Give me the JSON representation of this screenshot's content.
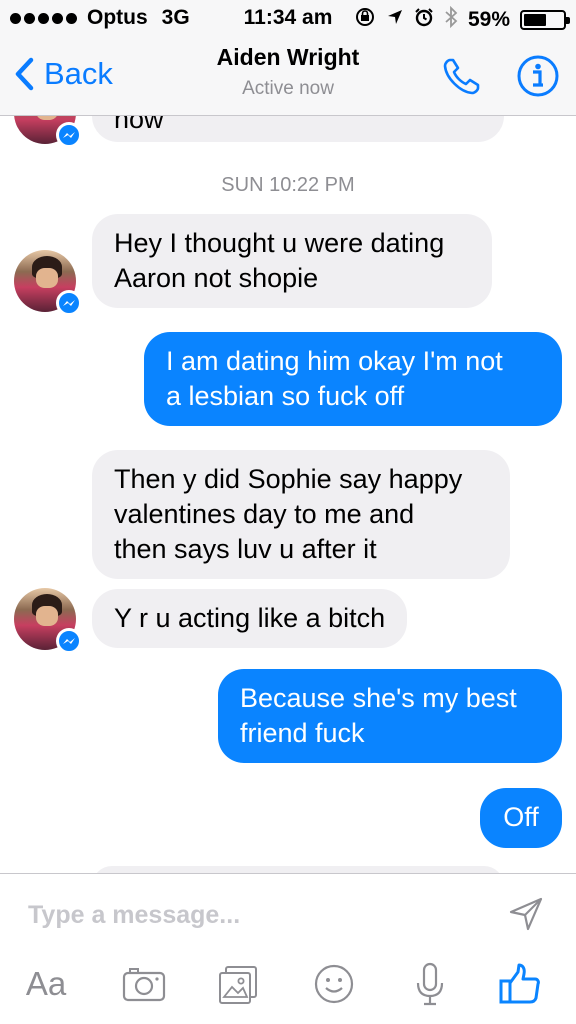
{
  "status_bar": {
    "carrier": "Optus",
    "network": "3G",
    "time": "11:34 am",
    "battery": "59%",
    "battery_level": 0.59
  },
  "nav": {
    "back_label": "Back",
    "contact_name": "Aiden Wright",
    "presence": "Active now"
  },
  "conversation": {
    "partial_top_text": "now",
    "timestamp": "SUN 10:22 PM",
    "messages": [
      {
        "sender": "them",
        "lines": [
          "Hey I thought u were dating",
          "Aaron not shopie"
        ]
      },
      {
        "sender": "me",
        "lines": [
          "I am dating him okay  I'm not",
          "a lesbian so fuck off"
        ]
      },
      {
        "sender": "them",
        "lines": [
          "Then y did Sophie say happy",
          "valentines day to me and",
          "then says luv u after it"
        ]
      },
      {
        "sender": "them",
        "lines": [
          "Y r u acting like a bitch"
        ]
      },
      {
        "sender": "me",
        "lines": [
          "Because she's my best",
          "friend fuck"
        ]
      },
      {
        "sender": "me",
        "lines": [
          "Off"
        ]
      }
    ]
  },
  "composer": {
    "placeholder": "Type a message...",
    "aa_label": "Aa"
  },
  "colors": {
    "accent": "#0a84ff",
    "incoming_bubble": "#f0eff2",
    "secondary_text": "#8e8e93"
  }
}
